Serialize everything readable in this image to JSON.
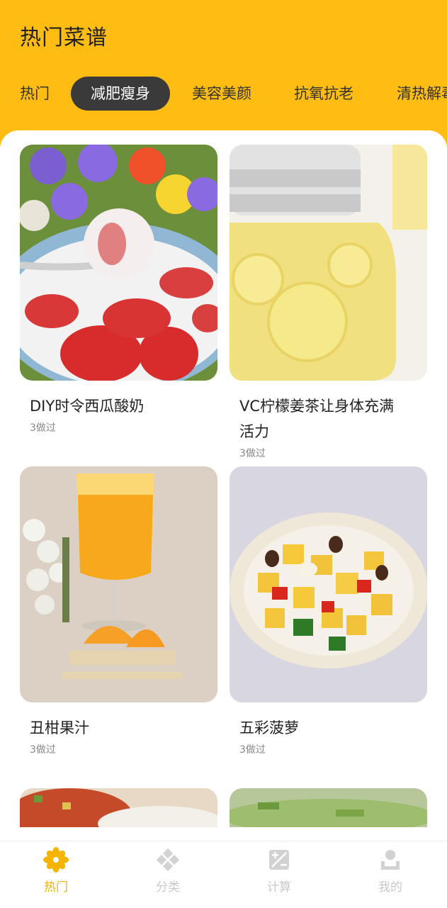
{
  "header": {
    "title": "热门菜谱"
  },
  "tabs": [
    {
      "label": "热门"
    },
    {
      "label": "减肥瘦身"
    },
    {
      "label": "美容美颜"
    },
    {
      "label": "抗氧抗老"
    },
    {
      "label": "清热解毒"
    }
  ],
  "recipes": [
    {
      "title": "DIY时令西瓜酸奶",
      "meta": "3做过"
    },
    {
      "title": "VC柠檬姜茶让身体充满活力",
      "meta": "3做过"
    },
    {
      "title": "丑柑果汁",
      "meta": "3做过"
    },
    {
      "title": "五彩菠萝",
      "meta": "3做过"
    }
  ],
  "nav": [
    {
      "label": "热门",
      "icon": "flower-icon"
    },
    {
      "label": "分类",
      "icon": "category-icon"
    },
    {
      "label": "计算",
      "icon": "calculator-icon"
    },
    {
      "label": "我的",
      "icon": "profile-icon"
    }
  ],
  "colors": {
    "accent": "#FFBC12",
    "nav_active": "#F5B400",
    "tab_active_bg": "#3A3A3A"
  }
}
